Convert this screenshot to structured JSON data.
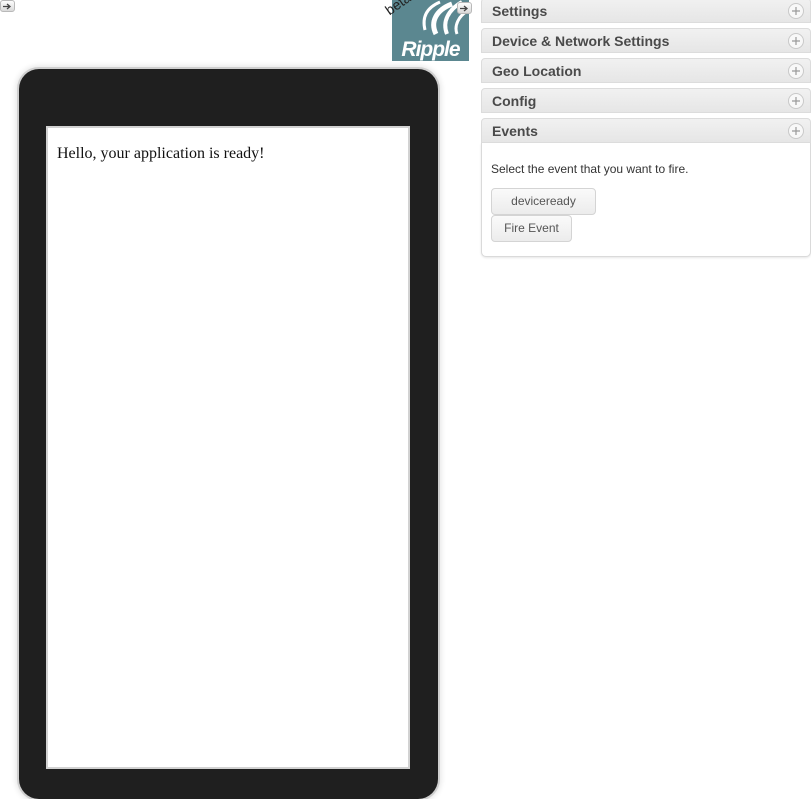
{
  "toolbar": {
    "left_toggle_icon": "arrow-right-icon",
    "right_toggle_icon": "arrow-right-icon"
  },
  "logo": {
    "text": "Ripple",
    "badge": "beta",
    "background_color": "#5b8790"
  },
  "device": {
    "frame_color": "#1f1f1f",
    "app_message": "Hello, your application is ready!"
  },
  "panels": [
    {
      "title": "Settings",
      "icon": "expand-icon"
    },
    {
      "title": "Device & Network Settings",
      "icon": "expand-icon"
    },
    {
      "title": "Geo Location",
      "icon": "expand-icon"
    },
    {
      "title": "Config",
      "icon": "expand-icon"
    },
    {
      "title": "Events",
      "icon": "expand-icon"
    }
  ],
  "events_panel": {
    "description": "Select the event that you want to fire.",
    "selected_event": "deviceready",
    "fire_label": "Fire Event"
  }
}
